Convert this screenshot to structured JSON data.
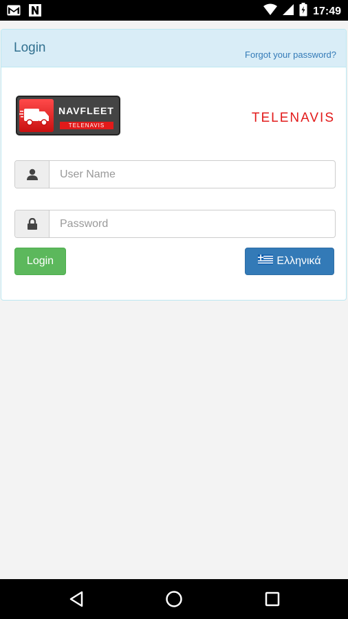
{
  "statusbar": {
    "time": "17:49",
    "icons": [
      "gmail-icon",
      "n-notification-icon",
      "wifi-icon",
      "signal-icon",
      "battery-icon"
    ]
  },
  "panel": {
    "title": "Login",
    "forgot_link": "Forgot your password?"
  },
  "logos": {
    "navfleet_brand": "NAVFLEET",
    "navfleet_sub": "TELENAVIS",
    "telenavis": "TELENAVIS"
  },
  "form": {
    "username_placeholder": "User Name",
    "username_value": "",
    "password_placeholder": "Password",
    "password_value": "",
    "login_button": "Login",
    "language_button": "Ελληνικά"
  },
  "colors": {
    "panel_header": "#d9edf7",
    "login_green": "#5cb85c",
    "language_blue": "#337ab7",
    "brand_red": "#e21a1a"
  },
  "navbar": {
    "icons": [
      "back-icon",
      "home-icon",
      "recents-icon"
    ]
  }
}
